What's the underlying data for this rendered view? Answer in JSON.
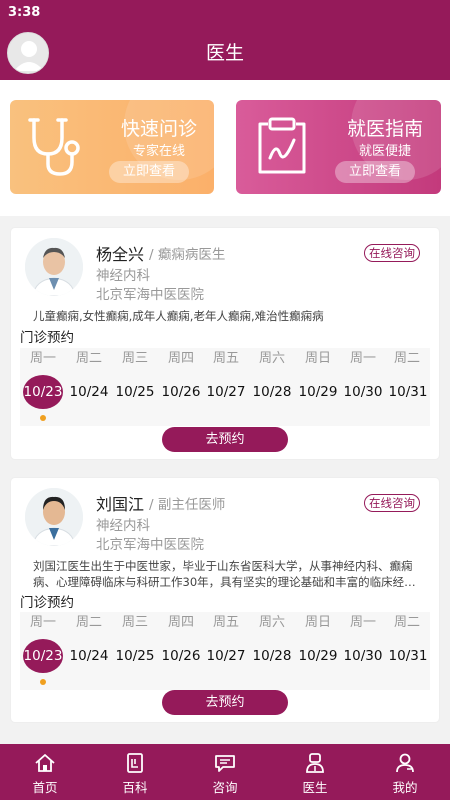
{
  "status": {
    "time": "3:38"
  },
  "header": {
    "title": "医生"
  },
  "banners": [
    {
      "title": "快速问诊",
      "subtitle": "专家在线",
      "button": "立即查看",
      "icon": "stethoscope-icon"
    },
    {
      "title": "就医指南",
      "subtitle": "就医便捷",
      "button": "立即查看",
      "icon": "guide-document-icon"
    }
  ],
  "doctors": [
    {
      "name": "杨全兴",
      "title": "/ 癫痫病医生",
      "dept": "神经内科",
      "hospital": "北京军海中医医院",
      "consult": "在线咨询",
      "desc": "儿童癫痫,女性癫痫,成年人癫痫,老年人癫痫,难治性癫痫病",
      "appointment_label": "门诊预约",
      "weekdays": [
        "周一",
        "周二",
        "周三",
        "周四",
        "周五",
        "周六",
        "周日",
        "周一",
        "周二"
      ],
      "dates": [
        "10/23",
        "10/24",
        "10/25",
        "10/26",
        "10/27",
        "10/28",
        "10/29",
        "10/30",
        "10/31"
      ],
      "selected_date": "10/23",
      "book_button": "去预约"
    },
    {
      "name": "刘国江",
      "title": "/ 副主任医师",
      "dept": "神经内科",
      "hospital": "北京军海中医医院",
      "consult": "在线咨询",
      "desc": "刘国江医生出生于中医世家，毕业于山东省医科大学，从事神经内科、癫痫病、心理障碍临床与科研工作30年，具有坚实的理论基础和丰富的临床经验。",
      "appointment_label": "门诊预约",
      "weekdays": [
        "周一",
        "周二",
        "周三",
        "周四",
        "周五",
        "周六",
        "周日",
        "周一",
        "周二"
      ],
      "dates": [
        "10/23",
        "10/24",
        "10/25",
        "10/26",
        "10/27",
        "10/28",
        "10/29",
        "10/30",
        "10/31"
      ],
      "selected_date": "10/23",
      "book_button": "去预约"
    }
  ],
  "tabs": [
    {
      "label": "首页",
      "icon": "home-icon"
    },
    {
      "label": "百科",
      "icon": "encyclopedia-icon"
    },
    {
      "label": "咨询",
      "icon": "chat-icon"
    },
    {
      "label": "医生",
      "icon": "doctor-icon"
    },
    {
      "label": "我的",
      "icon": "user-icon"
    }
  ],
  "colors": {
    "primary": "#951a5a",
    "banner_orange": "#fbb06a",
    "banner_pink": "#c33a7c",
    "dot": "#f0a020"
  }
}
